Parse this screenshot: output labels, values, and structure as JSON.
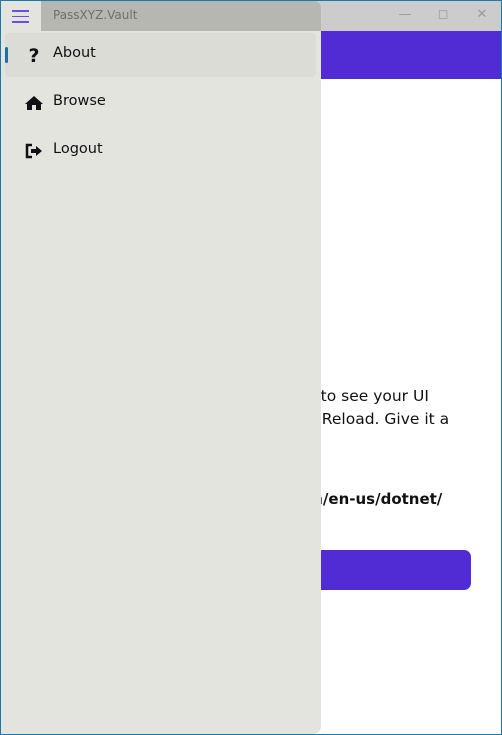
{
  "window": {
    "title": "PassXYZ.Vault",
    "controls": [
      "minimize-icon",
      "maximize-icon",
      "close-icon"
    ]
  },
  "colors": {
    "accent": "#512bd4",
    "flyout_bg": "#e4e4df",
    "selection_bar": "#1e6fa6"
  },
  "flyout": {
    "items": [
      {
        "label": "About",
        "icon": "question-icon",
        "selected": true
      },
      {
        "label": "Browse",
        "icon": "home-icon",
        "selected": false
      },
      {
        "label": "Logout",
        "icon": "sign-out-icon",
        "selected": false
      }
    ]
  },
  "main": {
    "line1": "ve to see your UI",
    "line2": "lot Reload. Give it a",
    "link": "om/en-us/dotnet/"
  }
}
